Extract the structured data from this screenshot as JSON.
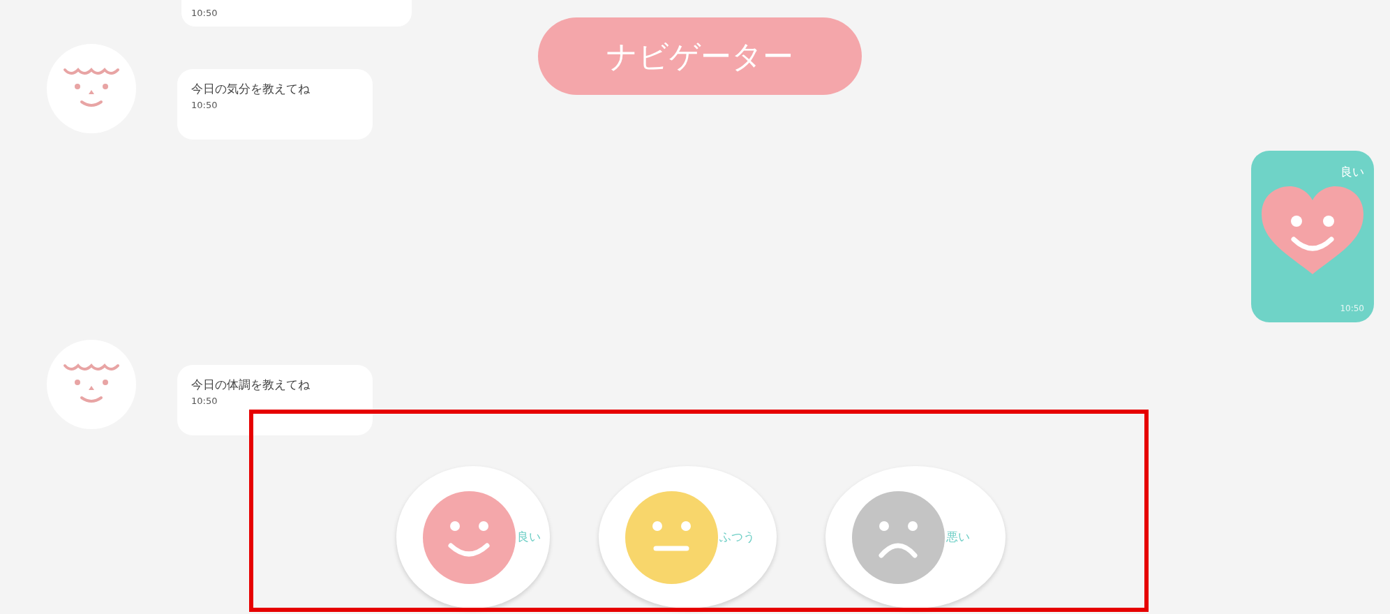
{
  "header": {
    "title": "ナビゲーター"
  },
  "messages": [
    {
      "kind": "bot_clipped",
      "time": "10:50"
    },
    {
      "kind": "bot",
      "text": "今日の気分を教えてね",
      "time": "10:50"
    },
    {
      "kind": "user",
      "text": "良い",
      "time": "10:50"
    },
    {
      "kind": "bot",
      "text": "今日の体調を教えてね",
      "time": "10:50"
    }
  ],
  "options": [
    {
      "label": "良い",
      "kind": "smile",
      "color": "#f4a7aa"
    },
    {
      "label": "ふつう",
      "kind": "neutral",
      "color": "#f8d66b"
    },
    {
      "label": "悪い",
      "kind": "frown",
      "color": "#c4c4c4"
    }
  ]
}
